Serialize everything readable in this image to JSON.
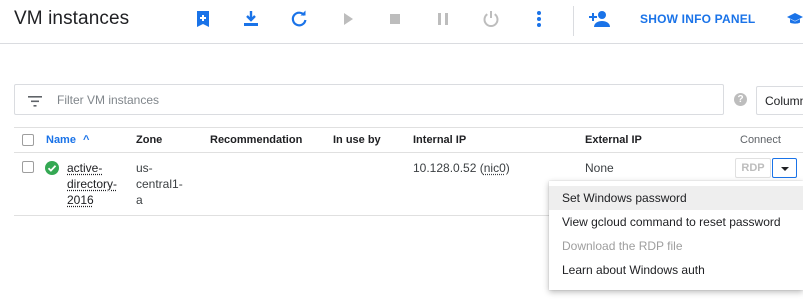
{
  "header": {
    "title": "VM instances",
    "show_info_panel_label": "SHOW INFO PANEL",
    "toolbar_icons": [
      "create-instance-icon",
      "import-vm-icon",
      "refresh-icon",
      "start-icon",
      "stop-icon",
      "pause-icon",
      "reset-icon",
      "more-vert-icon",
      "add-person-icon",
      "graduation-cap-icon"
    ],
    "accent_color": "#1a73e8"
  },
  "filter": {
    "placeholder": "Filter VM instances",
    "value": "",
    "help_icon_glyph": "?",
    "columns_label": "Columns"
  },
  "table": {
    "columns": {
      "name": "Name",
      "name_sort_arrow": "^",
      "zone": "Zone",
      "recommendation": "Recommendation",
      "in_use_by": "In use by",
      "internal_ip": "Internal IP",
      "external_ip": "External IP",
      "connect": "Connect"
    },
    "rows": [
      {
        "status": "running",
        "status_color": "#34a853",
        "name": "active-directory-2016",
        "zone": "us-central1-a",
        "recommendation": "",
        "in_use_by": "",
        "internal_ip": "10.128.0.52",
        "nic": "nic0",
        "external_ip": "None",
        "connect_label": "RDP"
      }
    ]
  },
  "menu": {
    "items": [
      {
        "label": "Set Windows password",
        "state": "hovered"
      },
      {
        "label": "View gcloud command to reset password",
        "state": "enabled"
      },
      {
        "label": "Download the RDP file",
        "state": "disabled"
      },
      {
        "label": "Learn about Windows auth",
        "state": "enabled"
      }
    ]
  }
}
